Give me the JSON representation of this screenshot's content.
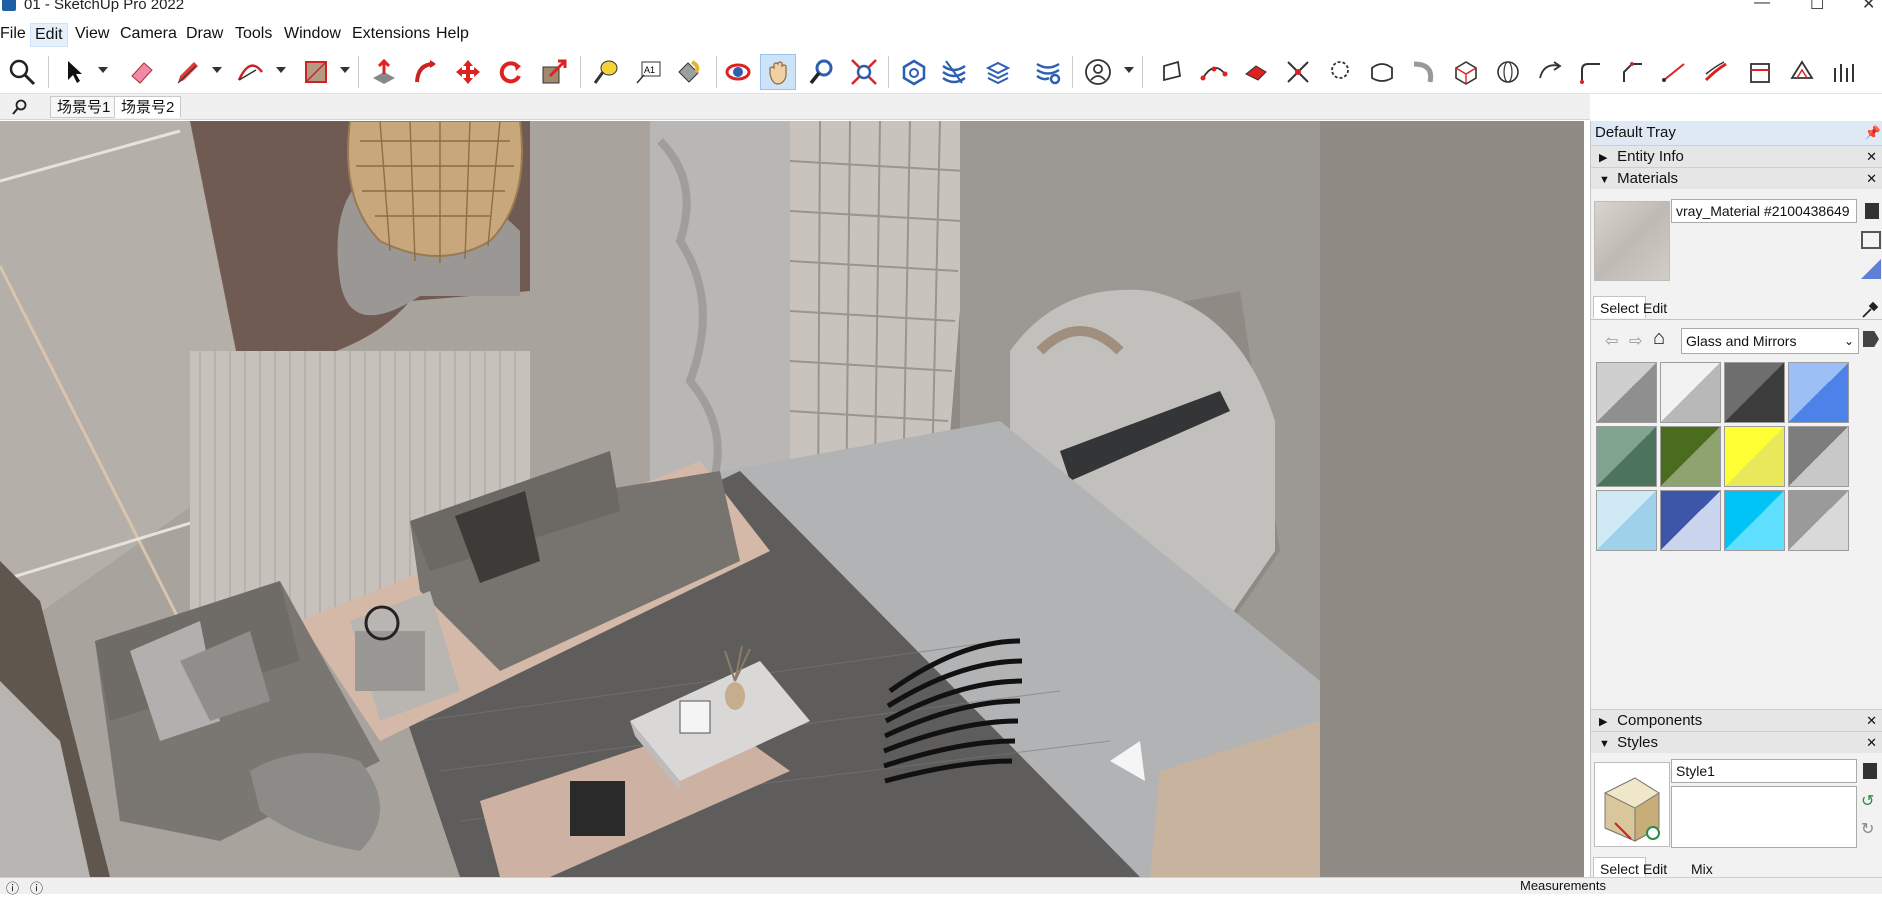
{
  "window": {
    "title": "01 - SketchUp Pro 2022",
    "minimize": "—",
    "maximize": "☐",
    "close": "✕"
  },
  "menu": [
    "File",
    "Edit",
    "View",
    "Camera",
    "Draw",
    "Tools",
    "Window",
    "Extensions",
    "Help"
  ],
  "toolbar": {
    "icons": [
      "search-icon",
      "select-arrow-icon",
      "eraser-icon",
      "pencil-line-icon",
      "arc-icon",
      "rectangle-icon",
      "push-pull-icon",
      "follow-me-icon",
      "move-icon",
      "rotate-icon",
      "scale-icon",
      "tape-measure-icon",
      "text-icon",
      "paint-bucket-icon",
      "orbit-icon",
      "pan-hand-icon",
      "zoom-icon",
      "zoom-extents-icon",
      "warehouse-icon",
      "section-plane-icon",
      "layers-icon",
      "tags-settings-icon",
      "user-account-icon"
    ]
  },
  "scenes": [
    "场景号1",
    "场景号2"
  ],
  "tray": {
    "title": "Default Tray",
    "entity_info": "Entity Info",
    "materials": "Materials",
    "material_name": "vray_Material #2100438649",
    "select_tab": "Select",
    "edit_tab": "Edit",
    "library": "Glass and Mirrors",
    "components": "Components",
    "styles": "Styles",
    "style_name": "Style1",
    "mix_tab": "Mix"
  },
  "swatches": [
    {
      "color_a": "#cfcfcf",
      "color_b": "#8f8f8f"
    },
    {
      "color_a": "#f2f2f2",
      "color_b": "#b8b8b8"
    },
    {
      "color_a": "#6e6e6e",
      "color_b": "#3c3c3c"
    },
    {
      "color_a": "#9cc0f5",
      "color_b": "#4d83e8"
    },
    {
      "color_a": "#7fa48f",
      "color_b": "#4c735c"
    },
    {
      "color_a": "#4b6b1e",
      "color_b": "#8fa36e"
    },
    {
      "color_a": "#ffff33",
      "color_b": "#e8e85a"
    },
    {
      "color_a": "#7d7d7d",
      "color_b": "#c8c8c8"
    },
    {
      "color_a": "#cfe9f5",
      "color_b": "#9fd1ea"
    },
    {
      "color_a": "#3d56a8",
      "color_b": "#c9d4ef"
    },
    {
      "color_a": "#00c4f5",
      "color_b": "#5fe0ff"
    },
    {
      "color_a": "#9a9a9a",
      "color_b": "#d9d9d9"
    }
  ],
  "status": {
    "measurements": "Measurements"
  }
}
